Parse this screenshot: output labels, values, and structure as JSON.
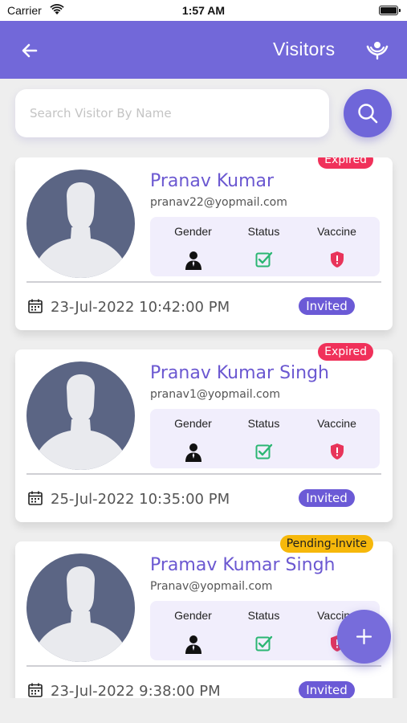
{
  "status_bar": {
    "carrier": "Carrier",
    "time": "1:57 AM"
  },
  "header": {
    "title": "Visitors",
    "back_icon": "arrow-left-icon",
    "logo_icon": "hands-logo-icon"
  },
  "search": {
    "placeholder": "Search Visitor By Name",
    "value": "",
    "button_icon": "search-icon"
  },
  "info_labels": {
    "gender": "Gender",
    "status": "Status",
    "vaccine": "Vaccine"
  },
  "colors": {
    "primary": "#7268d9",
    "name": "#6b58d1",
    "expired": "#f0315a",
    "pending": "#f6b80b",
    "check": "#2bb673",
    "vaccine": "#e8345a"
  },
  "visitors": [
    {
      "name": "Pranav Kumar",
      "email": "pranav22@yopmail.com",
      "badge": "Expired",
      "badge_type": "expired",
      "date": "23-Jul-2022 10:42:00 PM",
      "status": "Invited"
    },
    {
      "name": "Pranav Kumar Singh",
      "email": "pranav1@yopmail.com",
      "badge": "Expired",
      "badge_type": "expired",
      "date": "25-Jul-2022 10:35:00 PM",
      "status": "Invited"
    },
    {
      "name": "Pramav Kumar Singh",
      "email": "Pranav@yopmail.com",
      "badge": "Pending-Invite",
      "badge_type": "pending",
      "date": "23-Jul-2022 9:38:00 PM",
      "status": "Invited"
    }
  ],
  "fab": {
    "icon": "plus-icon"
  }
}
